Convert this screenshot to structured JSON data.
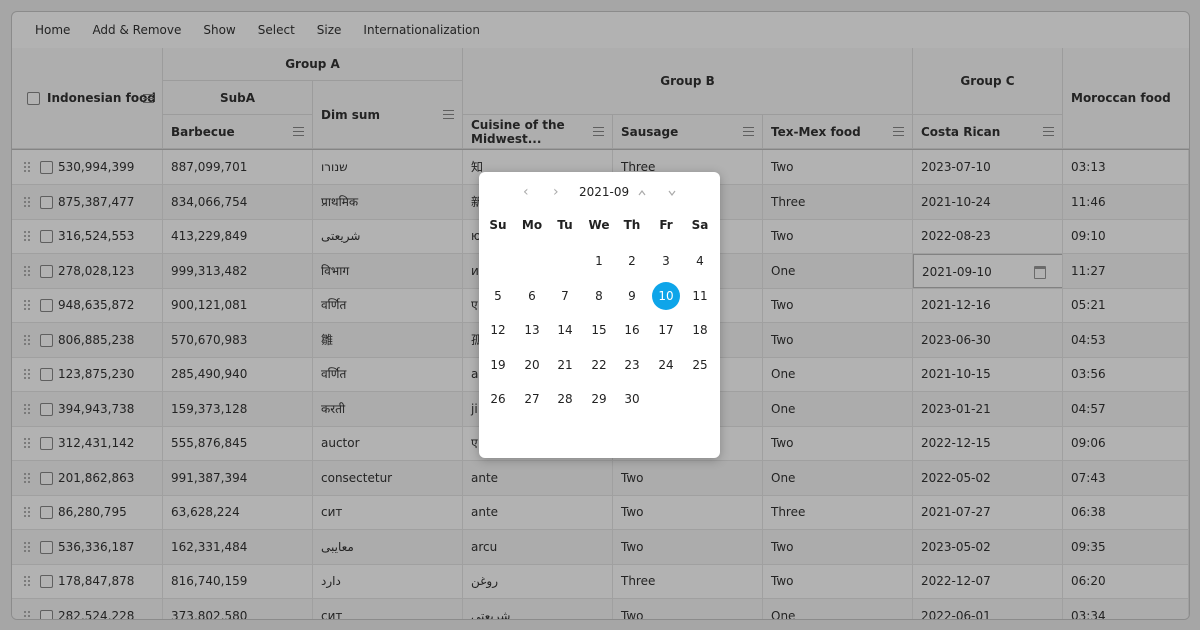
{
  "menu": [
    "Home",
    "Add & Remove",
    "Show",
    "Select",
    "Size",
    "Internationalization"
  ],
  "headers": {
    "indonesian": "Indonesian food",
    "groupA": "Group A",
    "subA": "SubA",
    "barbecue": "Barbecue",
    "dimsum": "Dim sum",
    "groupB": "Group B",
    "midwest": "Cuisine of the Midwest...",
    "sausage": "Sausage",
    "texmex": "Tex-Mex food",
    "groupC": "Group C",
    "costarican": "Costa Rican",
    "moroccan": "Moroccan food"
  },
  "rows": [
    [
      "530,994,399",
      "887,099,701",
      "שנורו",
      "知",
      "Three",
      "Two",
      "2023-07-10",
      "03:13"
    ],
    [
      "875,387,477",
      "834,066,754",
      "प्राथमिक",
      "新",
      "",
      "Three",
      "2021-10-24",
      "11:46"
    ],
    [
      "316,524,553",
      "413,229,849",
      "شريعتى",
      "ю",
      "",
      "Two",
      "2022-08-23",
      "09:10"
    ],
    [
      "278,028,123",
      "999,313,482",
      "विभाग",
      "и",
      "",
      "One",
      "2021-09-10",
      "11:27"
    ],
    [
      "948,635,872",
      "900,121,081",
      "वर्णित",
      "ए",
      "",
      "Two",
      "2021-12-16",
      "05:21"
    ],
    [
      "806,885,238",
      "570,670,983",
      "雛",
      "孤",
      "",
      "Two",
      "2023-06-30",
      "04:53"
    ],
    [
      "123,875,230",
      "285,490,940",
      "वर्णित",
      "ar",
      "",
      "One",
      "2021-10-15",
      "03:56"
    ],
    [
      "394,943,738",
      "159,373,128",
      "करती",
      "ji",
      "",
      "One",
      "2023-01-21",
      "04:57"
    ],
    [
      "312,431,142",
      "555,876,845",
      "auctor",
      "ए",
      "",
      "Two",
      "2022-12-15",
      "09:06"
    ],
    [
      "201,862,863",
      "991,387,394",
      "consectetur",
      "ante",
      "Two",
      "One",
      "2022-05-02",
      "07:43"
    ],
    [
      "86,280,795",
      "63,628,224",
      "сит",
      "ante",
      "Two",
      "Three",
      "2021-07-27",
      "06:38"
    ],
    [
      "536,336,187",
      "162,331,484",
      "معايبی",
      "arcu",
      "Two",
      "Two",
      "2023-05-02",
      "09:35"
    ],
    [
      "178,847,878",
      "816,740,159",
      "دارد",
      "روغن",
      "Three",
      "Two",
      "2022-12-07",
      "06:20"
    ],
    [
      "282,524,228",
      "373,802,580",
      "сит",
      "شريعتى",
      "Two",
      "One",
      "2022-06-01",
      "03:34"
    ]
  ],
  "datepicker": {
    "month": "2021-09",
    "prev_year": "‹",
    "prev_month": "›",
    "up": "^",
    "down": "ˇ",
    "weekdays": [
      "Su",
      "Mo",
      "Tu",
      "We",
      "Th",
      "Fr",
      "Sa"
    ],
    "days": [
      "1",
      "2",
      "3",
      "4",
      "5",
      "6",
      "7",
      "8",
      "9",
      "10",
      "11",
      "12",
      "13",
      "14",
      "15",
      "16",
      "17",
      "18",
      "19",
      "20",
      "21",
      "22",
      "23",
      "24",
      "25",
      "26",
      "27",
      "28",
      "29",
      "30"
    ],
    "first_weekday": 3,
    "selected": "10",
    "accent": "#0ea5e9"
  }
}
